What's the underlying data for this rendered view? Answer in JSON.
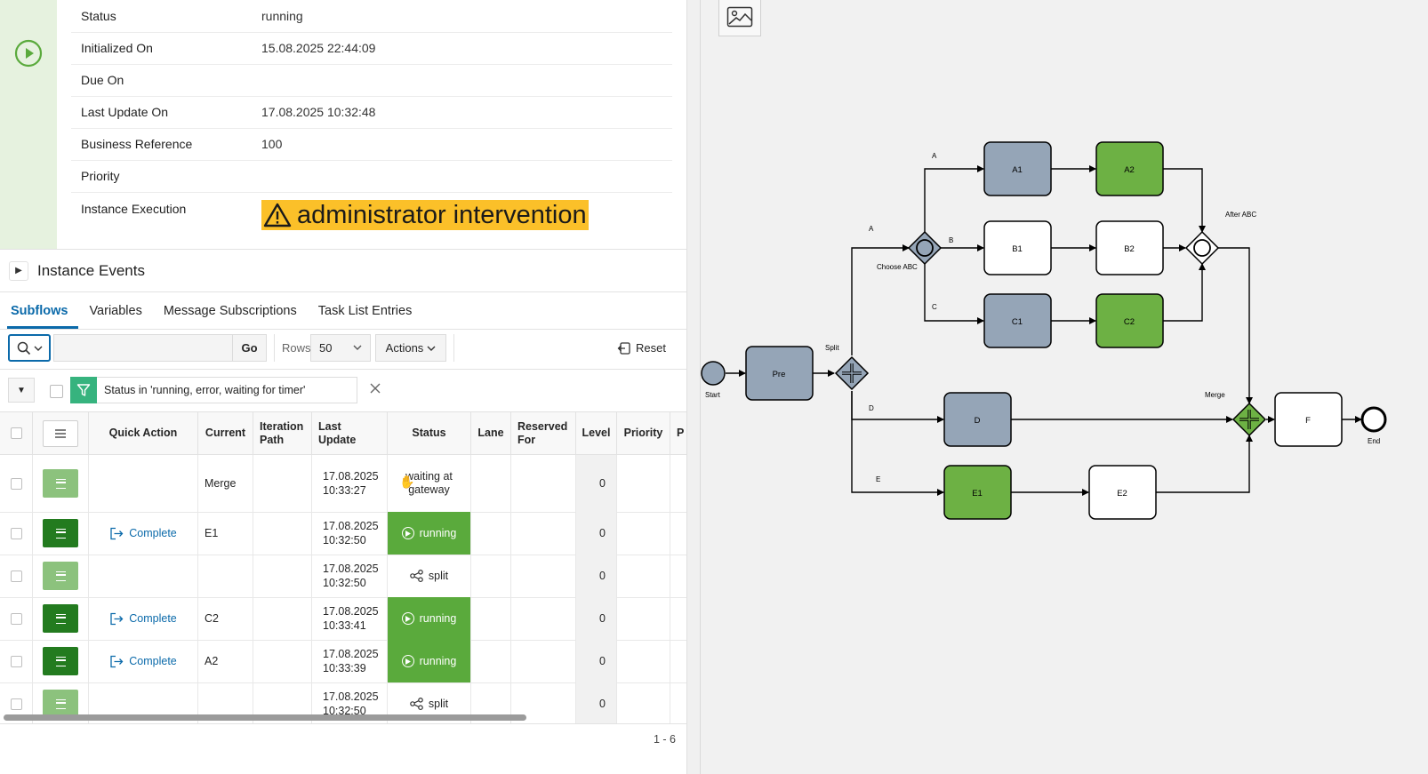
{
  "details": {
    "rows": [
      {
        "label": "Status",
        "value": "running"
      },
      {
        "label": "Initialized On",
        "value": "15.08.2025 22:44:09"
      },
      {
        "label": "Due On",
        "value": ""
      },
      {
        "label": "Last Update On",
        "value": "17.08.2025 10:32:48"
      },
      {
        "label": "Business Reference",
        "value": "100"
      },
      {
        "label": "Priority",
        "value": ""
      },
      {
        "label": "Instance Execution",
        "value": "administrator intervention"
      }
    ]
  },
  "events": {
    "title": "Instance Events"
  },
  "tabs": [
    "Subflows",
    "Variables",
    "Message Subscriptions",
    "Task List Entries"
  ],
  "toolbar": {
    "go_label": "Go",
    "rows_label": "Rows",
    "rows_value": "50",
    "actions_label": "Actions",
    "reset_label": "Reset"
  },
  "filter": {
    "text": "Status in 'running, error, waiting for timer'"
  },
  "grid": {
    "headers": [
      "Quick Action",
      "Current",
      "Iteration Path",
      "Last Update",
      "Status",
      "Lane",
      "Reserved For",
      "Level",
      "Priority",
      "P"
    ],
    "rows": [
      {
        "menu": "light",
        "action": "",
        "current": "Merge",
        "date": "17.08.2025",
        "time": "10:33:27",
        "status": "waiting at gateway",
        "status_type": "plain",
        "level": "0"
      },
      {
        "menu": "dark",
        "action": "Complete",
        "current": "E1",
        "date": "17.08.2025",
        "time": "10:32:50",
        "status": "running",
        "status_type": "running",
        "level": "0"
      },
      {
        "menu": "light",
        "action": "",
        "current": "",
        "date": "17.08.2025",
        "time": "10:32:50",
        "status": "split",
        "status_type": "split",
        "level": "0"
      },
      {
        "menu": "dark",
        "action": "Complete",
        "current": "C2",
        "date": "17.08.2025",
        "time": "10:33:41",
        "status": "running",
        "status_type": "running",
        "level": "0"
      },
      {
        "menu": "dark",
        "action": "Complete",
        "current": "A2",
        "date": "17.08.2025",
        "time": "10:33:39",
        "status": "running",
        "status_type": "running",
        "level": "0"
      },
      {
        "menu": "light",
        "action": "",
        "current": "",
        "date": "17.08.2025",
        "time": "10:32:50",
        "status": "split",
        "status_type": "split",
        "level": "0"
      }
    ],
    "pagination": "1 - 6"
  },
  "diagram": {
    "colors": {
      "done": "#95a5b7",
      "active": "#6db144",
      "pending": "#ffffff"
    },
    "nodes": {
      "start": "Start",
      "end": "End",
      "pre": "Pre",
      "split": "Split",
      "choose": "Choose ABC",
      "after": "After ABC",
      "merge": "Merge",
      "a1": "A1",
      "a2": "A2",
      "b1": "B1",
      "b2": "B2",
      "c1": "C1",
      "c2": "C2",
      "d": "D",
      "e1": "E1",
      "e2": "E2",
      "f": "F"
    },
    "flows": {
      "a_top": "A",
      "a": "A",
      "b": "B",
      "c": "C",
      "d": "D",
      "e": "E"
    }
  }
}
